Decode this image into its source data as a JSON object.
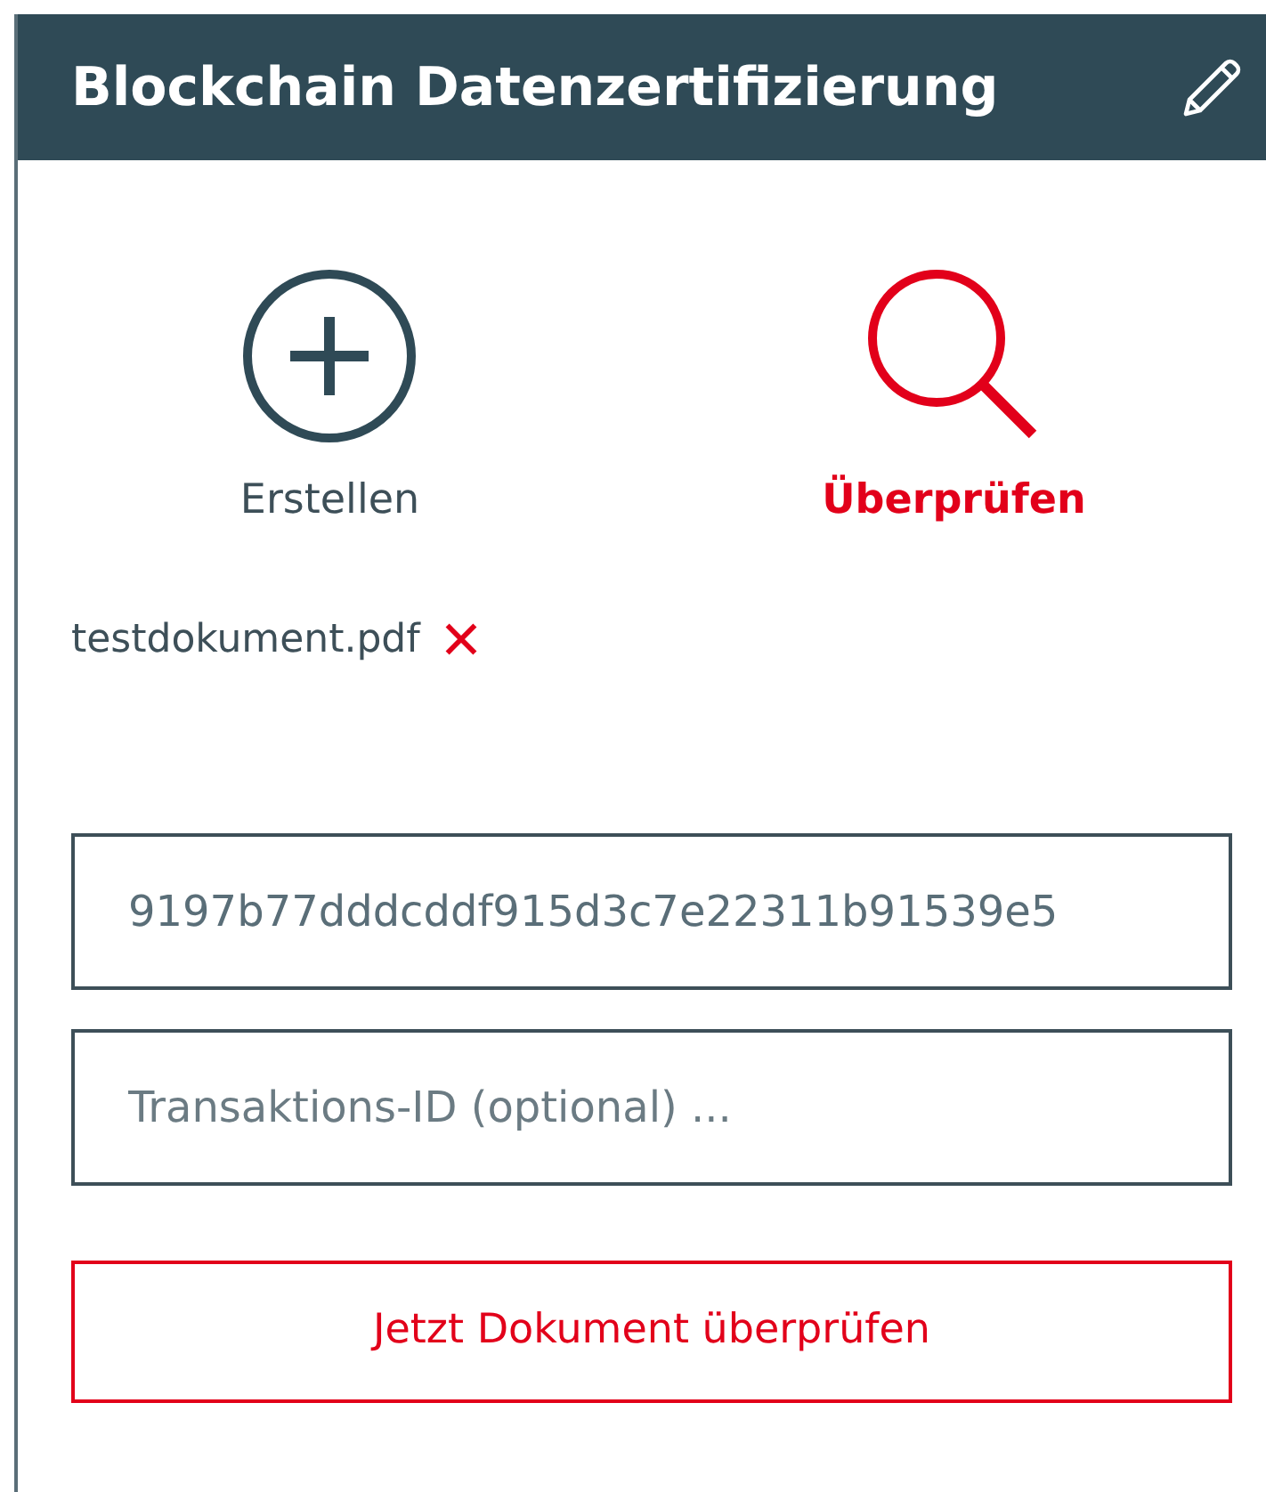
{
  "header": {
    "title": "Blockchain Datenzertifizierung"
  },
  "modes": [
    {
      "kind": "create",
      "label": "Erstellen",
      "selected": false
    },
    {
      "kind": "verify",
      "label": "Überprüfen",
      "selected": true
    }
  ],
  "file": {
    "name": "testdokument.pdf"
  },
  "fields": [
    {
      "value": "9197b77dddcddf915d3c7e22311b91539e5"
    },
    {
      "placeholder": "Transaktions-ID (optional) ..."
    }
  ],
  "submit_button": "Jetzt Dokument überprüfen"
}
